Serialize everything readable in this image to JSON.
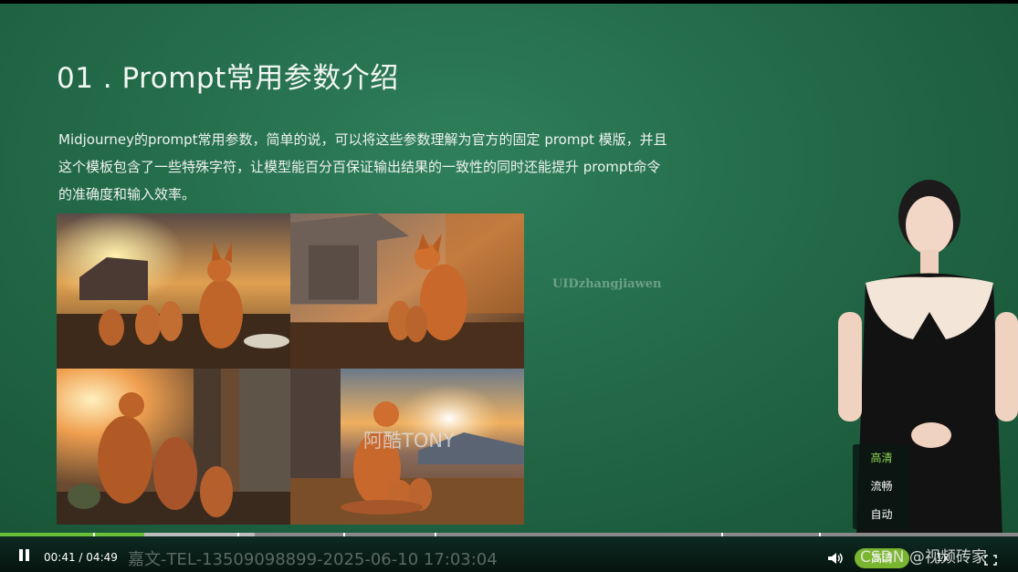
{
  "slide": {
    "title": "01 . Prompt常用参数介绍",
    "body_lines": [
      "Midjourney的prompt常用参数，简单的说，可以将这些参数理解为官方的固定 prompt 模版，并且",
      "这个模板包含了一些特殊字符，让模型能百分百保证输出结果的一致性的同时还能提升 prompt命令",
      "的准确度和输入效率。"
    ]
  },
  "watermarks": {
    "user_id": "UIDzhangjiawen",
    "overlay_name": "阿酷TONY",
    "tel_line": "嘉文-TEL-13509098899-2025-06-10 17:03:04",
    "csdn": "CSDN @视频砖家"
  },
  "quality_menu": {
    "options": [
      "高清",
      "流畅",
      "自动"
    ],
    "selected": "高清",
    "active_color": "#8fd14f"
  },
  "player": {
    "current_time": "00:41",
    "separator": "/",
    "duration": "04:49",
    "progress_fraction": 0.142,
    "buffered_fraction": 0.25,
    "quality_label": "高清",
    "speed_label": "1x",
    "accent_color": "#79b52f",
    "icons": [
      "pause-icon",
      "volume-icon",
      "fullscreen-icon"
    ]
  }
}
